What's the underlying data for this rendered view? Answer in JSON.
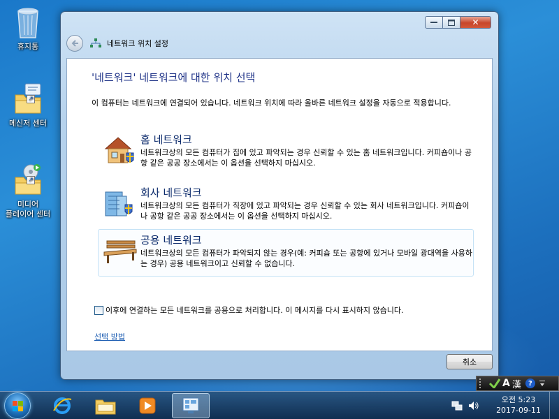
{
  "desktop": {
    "icons": [
      {
        "label": "휴지통"
      },
      {
        "label": "메신저 센터"
      },
      {
        "label": "미디어\n플레이어 센터"
      }
    ]
  },
  "window": {
    "title": "네트워크 위치 설정",
    "heading": "'네트워크' 네트워크에 대한 위치 선택",
    "intro": "이 컴퓨터는 네트워크에 연결되어 있습니다. 네트워크 위치에 따라 올바른 네트워크 설정을 자동으로 적용합니다.",
    "options": [
      {
        "title": "홈 네트워크",
        "desc": "네트워크상의 모든 컴퓨터가 집에 있고 파악되는 경우 신뢰할 수 있는 홈 네트워크입니다. 커피숍이나 공항 같은 공공 장소에서는 이 옵션을 선택하지 마십시오."
      },
      {
        "title": "회사 네트워크",
        "desc": "네트워크상의 모든 컴퓨터가 직장에 있고 파악되는 경우 신뢰할 수 있는 회사 네트워크입니다. 커피숍이나 공항 같은 공공 장소에서는 이 옵션을 선택하지 마십시오."
      },
      {
        "title": "공용 네트워크",
        "desc": "네트워크상의 모든 컴퓨터가 파악되지 않는 경우(예: 커피숍 또는 공항에 있거나 모바일 광대역을 사용하는 경우) 공용 네트워크이고 신뢰할 수 없습니다."
      }
    ],
    "checkbox_label": "이후에 연결하는 모든 네트워크를 공용으로 처리합니다. 이 메시지를 다시 표시하지 않습니다.",
    "link": "선택 방법",
    "cancel": "취소",
    "close_glyph": "✕"
  },
  "langbar": {
    "a": "A",
    "han": "漢",
    "help": "?"
  },
  "taskbar": {
    "time": "오전 5:23",
    "date": "2017-09-11"
  }
}
